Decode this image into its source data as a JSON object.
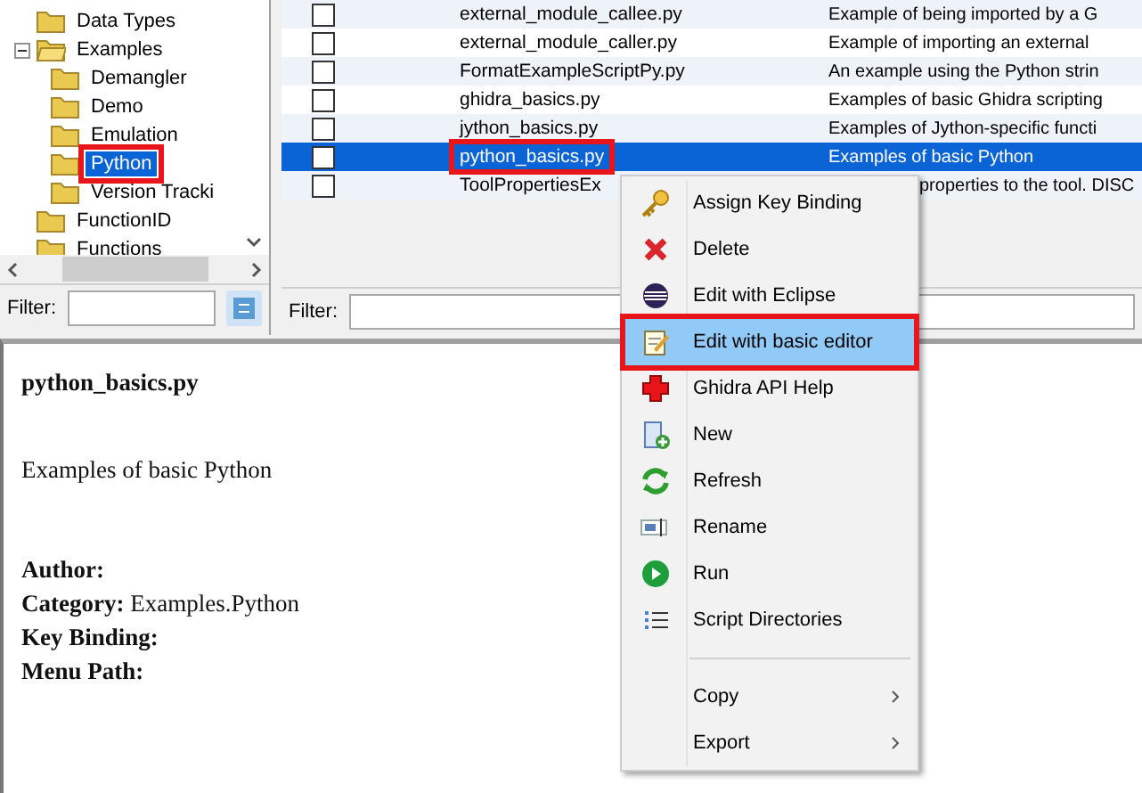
{
  "tree": {
    "items": [
      {
        "label": "Data Types",
        "expanded": false,
        "selected": false,
        "outlined": false
      },
      {
        "label": "Examples",
        "expanded": true,
        "selected": false,
        "outlined": false,
        "children": [
          {
            "label": "Demangler",
            "selected": false,
            "outlined": false
          },
          {
            "label": "Demo",
            "selected": false,
            "outlined": false
          },
          {
            "label": "Emulation",
            "selected": false,
            "outlined": false
          },
          {
            "label": "Python",
            "selected": true,
            "outlined": true
          },
          {
            "label": "Version Tracki",
            "selected": false,
            "outlined": false
          }
        ]
      },
      {
        "label": "FunctionID",
        "expanded": false,
        "selected": false,
        "outlined": false
      },
      {
        "label": "Functions",
        "expanded": false,
        "selected": false,
        "outlined": false
      }
    ]
  },
  "tree_filter": {
    "label": "Filter:"
  },
  "scripts": {
    "rows": [
      {
        "checked": false,
        "name": "external_module_callee.py",
        "description": "Example of being imported by a G",
        "selected": false,
        "outlined": false,
        "covered": false
      },
      {
        "checked": false,
        "name": "external_module_caller.py",
        "description": "Example of importing an external",
        "selected": false,
        "outlined": false,
        "covered": false
      },
      {
        "checked": false,
        "name": "FormatExampleScriptPy.py",
        "description": "An example using the Python strin",
        "selected": false,
        "outlined": false,
        "covered": false
      },
      {
        "checked": false,
        "name": "ghidra_basics.py",
        "description": "Examples of basic Ghidra scripting",
        "selected": false,
        "outlined": false,
        "covered": false
      },
      {
        "checked": false,
        "name": "jython_basics.py",
        "description": "Examples of Jython-specific functi",
        "selected": false,
        "outlined": false,
        "covered": false
      },
      {
        "checked": false,
        "name": "python_basics.py",
        "description": "Examples of basic Python",
        "selected": true,
        "outlined": true,
        "covered": false
      },
      {
        "checked": false,
        "name": "ToolPropertiesEx",
        "description": "properties to the tool. DISC",
        "selected": false,
        "outlined": false,
        "covered": true
      }
    ]
  },
  "scripts_filter": {
    "label": "Filter:"
  },
  "details": {
    "title": "python_basics.py",
    "description": "Examples of basic Python",
    "fields": [
      {
        "label": "Author:"
      },
      {
        "label": "Category:",
        "value": "Examples.Python"
      },
      {
        "label": "Key Binding:"
      },
      {
        "label": "Menu Path:"
      }
    ]
  },
  "context_menu": {
    "items": [
      {
        "kind": "action",
        "label": "Assign Key Binding",
        "selected": false,
        "outlined": false
      },
      {
        "kind": "action",
        "label": "Delete",
        "selected": false,
        "outlined": false
      },
      {
        "kind": "action",
        "label": "Edit with Eclipse",
        "selected": false,
        "outlined": false
      },
      {
        "kind": "action",
        "label": "Edit with basic editor",
        "selected": true,
        "outlined": true
      },
      {
        "kind": "action",
        "label": "Ghidra API Help",
        "selected": false,
        "outlined": false
      },
      {
        "kind": "action",
        "label": "New",
        "selected": false,
        "outlined": false
      },
      {
        "kind": "action",
        "label": "Refresh",
        "selected": false,
        "outlined": false
      },
      {
        "kind": "action",
        "label": "Rename",
        "selected": false,
        "outlined": false
      },
      {
        "kind": "action",
        "label": "Run",
        "selected": false,
        "outlined": false
      },
      {
        "kind": "action",
        "label": "Script Directories",
        "selected": false,
        "outlined": false
      },
      {
        "kind": "separator"
      },
      {
        "kind": "submenu",
        "label": "Copy",
        "selected": false,
        "outlined": false
      },
      {
        "kind": "submenu",
        "label": "Export",
        "selected": false,
        "outlined": false
      }
    ]
  }
}
